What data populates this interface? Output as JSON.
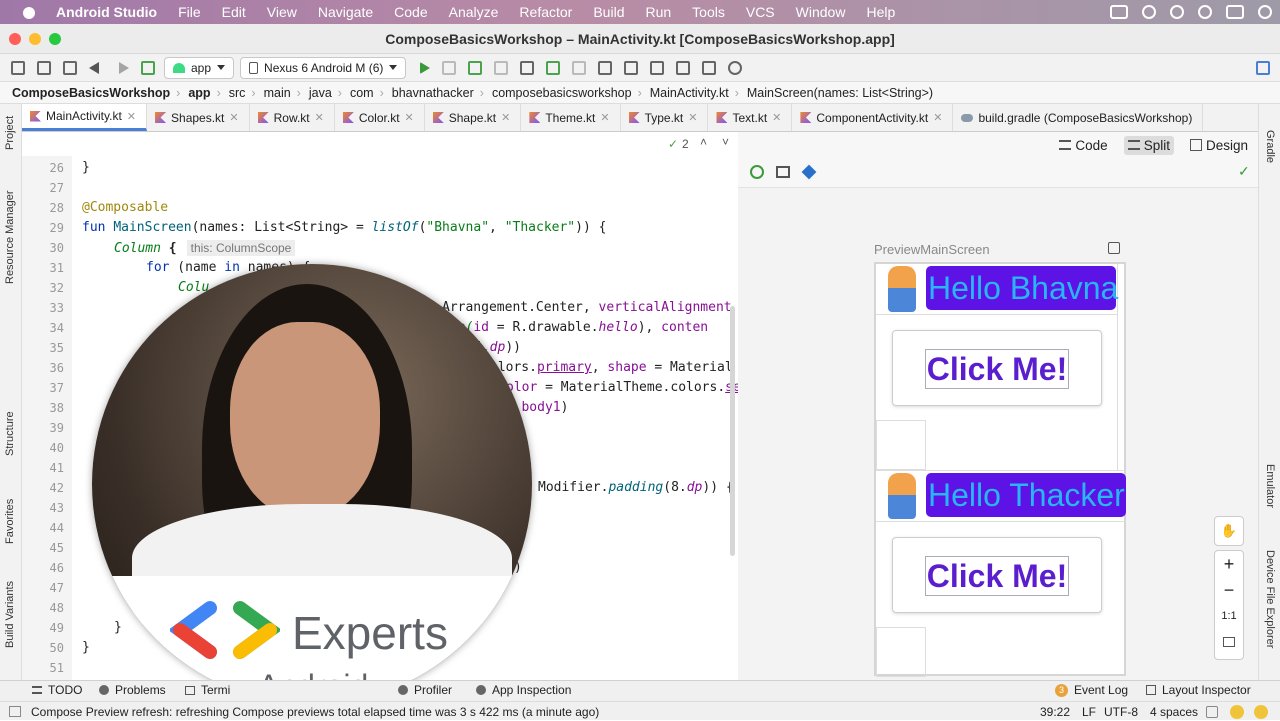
{
  "menubar": {
    "app": "Android Studio",
    "items": [
      "File",
      "Edit",
      "View",
      "Navigate",
      "Code",
      "Analyze",
      "Refactor",
      "Build",
      "Run",
      "Tools",
      "VCS",
      "Window",
      "Help"
    ]
  },
  "window": {
    "title": "ComposeBasicsWorkshop – MainActivity.kt [ComposeBasicsWorkshop.app]"
  },
  "toolbar": {
    "module": "app",
    "device": "Nexus 6 Android M (6)"
  },
  "breadcrumb": [
    "ComposeBasicsWorkshop",
    "app",
    "src",
    "main",
    "java",
    "com",
    "bhavnathacker",
    "composebasicsworkshop",
    "MainActivity.kt",
    "MainScreen(names: List<String>)"
  ],
  "tabs": [
    "MainActivity.kt",
    "Shapes.kt",
    "Row.kt",
    "Color.kt",
    "Shape.kt",
    "Theme.kt",
    "Type.kt",
    "Text.kt",
    "ComponentActivity.kt",
    "build.gradle (ComposeBasicsWorkshop)"
  ],
  "left_tools": [
    "Project",
    "Resource Manager",
    "Structure",
    "Favorites",
    "Build Variants"
  ],
  "right_tools": [
    "Gradle",
    "Emulator",
    "Device File Explorer"
  ],
  "editor": {
    "inspection_count": "2",
    "hint": "this: ColumnScope",
    "line_numbers": [
      "26",
      "27",
      "28",
      "29",
      "30",
      "31",
      "32",
      "33",
      "34",
      "35",
      "36",
      "37",
      "38",
      "39",
      "40",
      "41",
      "42",
      "43",
      "44",
      "45",
      "46",
      "47",
      "48",
      "49",
      "50",
      "51"
    ],
    "fragments": {
      "l26": "}",
      "l28": "@Composable",
      "l29_fun": "fun ",
      "l29_name": "MainScreen",
      "l29_a": "(names: List<String> = ",
      "l29_listof": "listOf",
      "l29_b": "(",
      "l29_s1": "\"Bhavna\"",
      "l29_c": ", ",
      "l29_s2": "\"Thacker\"",
      "l29_d": ")) {",
      "l30": "Column",
      "l30b": " {",
      "l31_for": "for",
      "l31_a": " (name ",
      "l31_in": "in",
      "l31_b": " names) {",
      "l32": "Colu",
      "l33": "Arrangement.Center, ",
      "l33b": "verticalAlignment",
      "l34": "rce(",
      "l34b": "id",
      "l34c": " = R.drawable.",
      "l34d": "hello",
      "l34e": "), ",
      "l34f": "conten",
      "l35": "4.",
      "l35b": "dp",
      "l35c": "))",
      "l36": "olors.",
      "l36b": "primary",
      "l36c": ", ",
      "l36d": "shape",
      "l36e": " = Material",
      "l37": "olor",
      "l37b": " = MaterialTheme.colors.",
      "l37c": "se",
      "l38": "hy.",
      "l38b": "body1",
      "l38c": ")",
      "l42": "Modifier.",
      "l42b": "padding",
      "l42c": "(8.",
      "l42d": "dp",
      "l42e": ")) {",
      "l46": ")",
      "l49": "}",
      "l50": "}"
    }
  },
  "view_modes": {
    "code": "Code",
    "split": "Split",
    "design": "Design"
  },
  "preview": {
    "name": "PreviewMainScreen",
    "cards": [
      {
        "greeting": "Hello Bhavna",
        "button": "Click Me!"
      },
      {
        "greeting": "Hello Thacker",
        "button": "Click Me!"
      }
    ],
    "zoom_fit": "1:1"
  },
  "overlay": {
    "brand": "Experts",
    "sub": "Android"
  },
  "bottom_tabs": {
    "todo": "TODO",
    "problems": "Problems",
    "terminal": "Termi",
    "profiler": "Profiler",
    "app_inspection": "App Inspection",
    "event_log": "Event Log",
    "event_count": "3",
    "layout_inspector": "Layout Inspector"
  },
  "status": {
    "message": "Compose Preview refresh: refreshing Compose previews total elapsed time was 3 s 422 ms (a minute ago)",
    "position": "39:22",
    "line_sep": "LF",
    "encoding": "UTF-8",
    "indent": "4 spaces"
  },
  "colors": {
    "accent": "#4a7fd8",
    "preview_purple": "#5d12e6",
    "hello_text": "#29b6f6",
    "button_text": "#5b1ecf"
  }
}
